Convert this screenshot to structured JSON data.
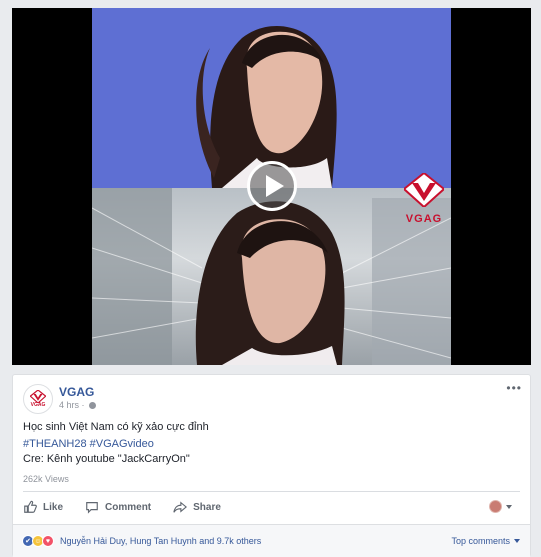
{
  "video": {
    "watermark": "VGAG"
  },
  "post": {
    "page_name": "VGAG",
    "logo_text": "VGAG",
    "time": "4 hrs",
    "more_label": "•••",
    "caption": "Học sinh Việt Nam có kỹ xảo cực đỉnh",
    "hashtags": [
      "#THEANH28",
      "#VGAGvideo"
    ],
    "credit": "Cre: Kênh youtube \"JackCarryOn\"",
    "views": "262k Views"
  },
  "actions": {
    "like": "Like",
    "comment": "Comment",
    "share": "Share"
  },
  "reactions": {
    "summary": "Nguyễn Hải Duy, Hung Tan Huynh and 9.7k others",
    "sort_label": "Top comments",
    "emoji_haha": "☺",
    "emoji_like": "✔",
    "emoji_love": "♥"
  },
  "colors": {
    "link": "#365899",
    "brand_red": "#c8102e",
    "bg": "#e9ebee"
  }
}
